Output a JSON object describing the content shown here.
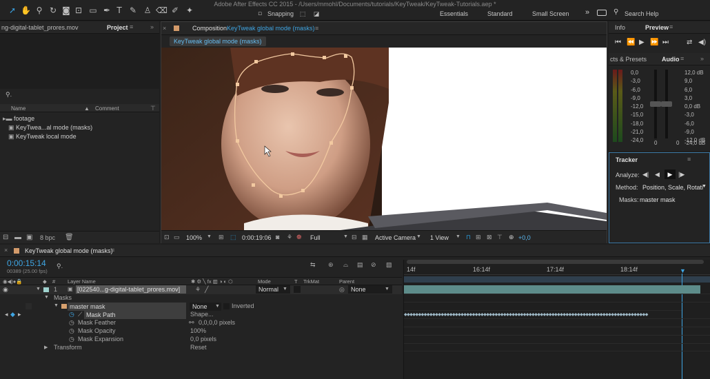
{
  "window": {
    "title": "Adobe After Effects CC 2015 - /Users/mmohl/Documents/tutorials/KeyTweak/KeyTweak-Tutorials.aep *"
  },
  "toolbar": {
    "snapping": "Snapping",
    "workspaces": [
      "Essentials",
      "Standard",
      "Small Screen"
    ],
    "search_placeholder": "Search Help"
  },
  "project": {
    "source_tab": "ng-digital-tablet_prores.mov",
    "tab": "Project",
    "columns": {
      "name": "Name",
      "comment": "Comment"
    },
    "items": [
      {
        "label": "footage"
      },
      {
        "label": "KeyTwea...al mode (masks)"
      },
      {
        "label": "KeyTweak local mode"
      }
    ],
    "bpc": "8 bpc"
  },
  "composition": {
    "tab_prefix": "Composition",
    "tab_name": "KeyTweak global mode (masks)",
    "breadcrumb": "KeyTweak global mode (masks)"
  },
  "viewer": {
    "zoom": "100%",
    "timecode": "0:00:19:06",
    "resolution": "Full",
    "camera": "Active Camera",
    "views": "1 View",
    "exposure": "+0,0"
  },
  "info_panel": {
    "tabs": [
      "Info",
      "Preview"
    ]
  },
  "audio_panel": {
    "tabs": [
      "cts & Presets",
      "Audio"
    ],
    "left_scale": [
      "0,0",
      "-3,0",
      "-6,0",
      "-9,0",
      "-12,0",
      "-15,0",
      "-18,0",
      "-21,0",
      "-24,0"
    ],
    "right_scale": [
      "12,0 dB",
      "9,0",
      "6,0",
      "3,0",
      "0,0 dB",
      "-3,0",
      "-6,0",
      "-9,0",
      "-12,0 dB"
    ],
    "bottom_labels": [
      "0",
      "0"
    ],
    "right_bottom": "-24,0 dB"
  },
  "tracker": {
    "title": "Tracker",
    "analyze_label": "Analyze:",
    "method_label": "Method:",
    "method_value": "Position, Scale, Rotati",
    "masks_label": "Masks:",
    "masks_value": "master mask"
  },
  "timeline": {
    "tab": "KeyTweak global mode (masks)",
    "current_time": "0:00:15:14",
    "fps": "00389 (25.00 fps)",
    "columns": {
      "num": "#",
      "layer_name": "Layer Name",
      "mode": "Mode",
      "t": "T",
      "trkmat": "TrkMat",
      "parent": "Parent"
    },
    "ruler": [
      "14f",
      "16:14f",
      "17:14f",
      "18:14f"
    ],
    "layer": {
      "num": "1",
      "name": "[022540...g-digital-tablet_prores.mov]",
      "mode": "Normal",
      "parent": "None"
    },
    "masks_group": "Masks",
    "mask": {
      "name": "master mask",
      "mode": "None",
      "inverted": "Inverted"
    },
    "props": [
      {
        "name": "Mask Path",
        "value": "Shape..."
      },
      {
        "name": "Mask Feather",
        "value": "0,0,0,0 pixels"
      },
      {
        "name": "Mask Opacity",
        "value": "100%"
      },
      {
        "name": "Mask Expansion",
        "value": "0,0 pixels"
      }
    ],
    "transform": {
      "name": "Transform",
      "value": "Reset"
    }
  }
}
